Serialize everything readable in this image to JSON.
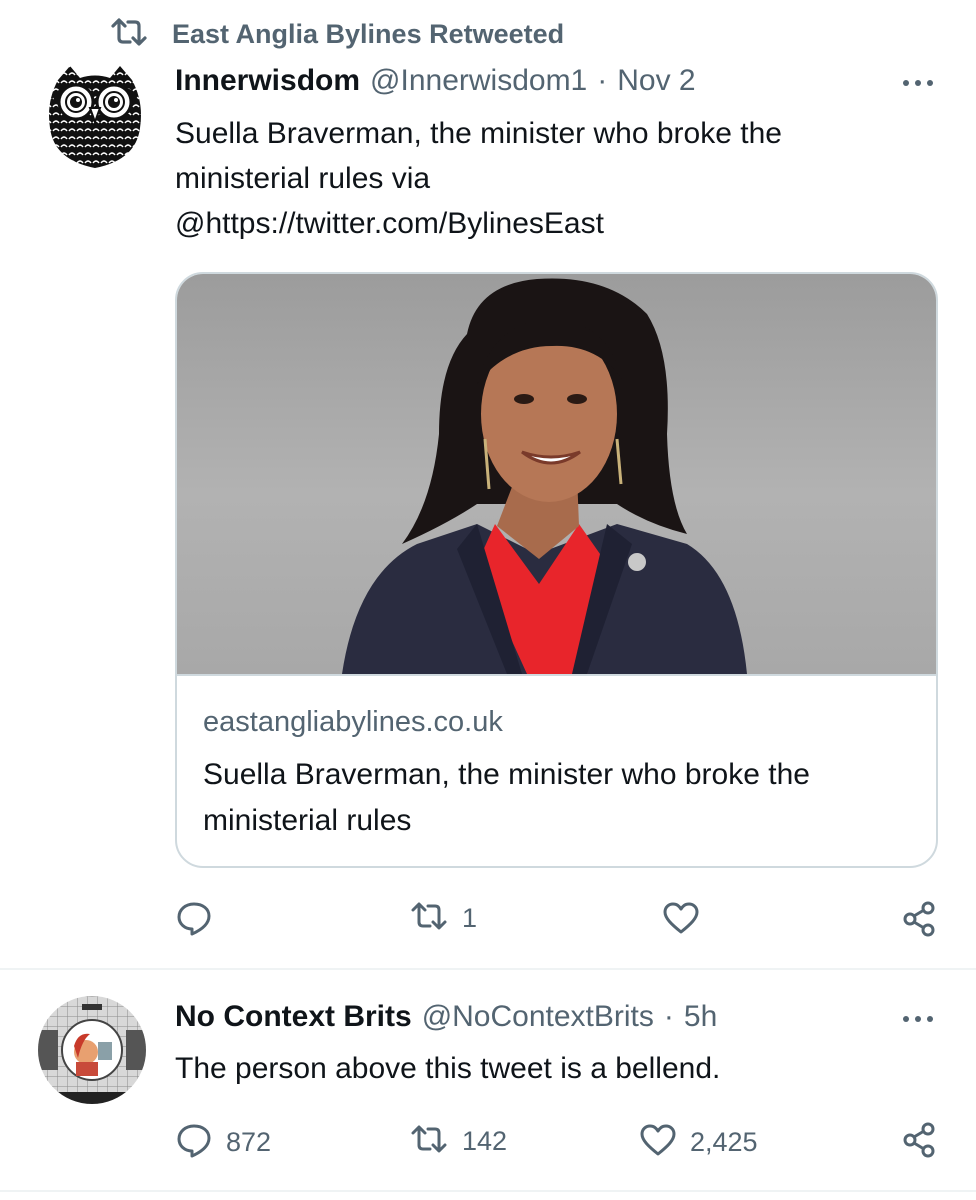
{
  "retweet_banner": {
    "label": "East Anglia Bylines Retweeted",
    "icon": "retweet-icon"
  },
  "tweet1": {
    "avatar": "owl-avatar",
    "name": "Innerwisdom",
    "handle": "@Innerwisdom1",
    "separator": "·",
    "time": "Nov 2",
    "text_lines": [
      "Suella Braverman, the minister who broke the",
      "ministerial rules via",
      "@https://twitter.com/BylinesEast"
    ],
    "card": {
      "image": "portrait-photo",
      "domain": "eastangliabylines.co.uk",
      "title_lines": [
        "Suella Braverman, the minister who broke the",
        "ministerial rules"
      ]
    },
    "actions": {
      "reply_count": "",
      "retweet_count": "1",
      "like_count": ""
    }
  },
  "tweet2": {
    "avatar": "test-card-avatar",
    "name": "No Context Brits",
    "handle": "@NoContextBrits",
    "separator": "·",
    "time": "5h",
    "text": "The person above this tweet is a bellend.",
    "actions": {
      "reply_count": "872",
      "retweet_count": "142",
      "like_count": "2,425"
    }
  },
  "colors": {
    "text": "#0f1419",
    "secondary": "#536471",
    "border": "#cfd9de",
    "accent": "#e8252b"
  }
}
